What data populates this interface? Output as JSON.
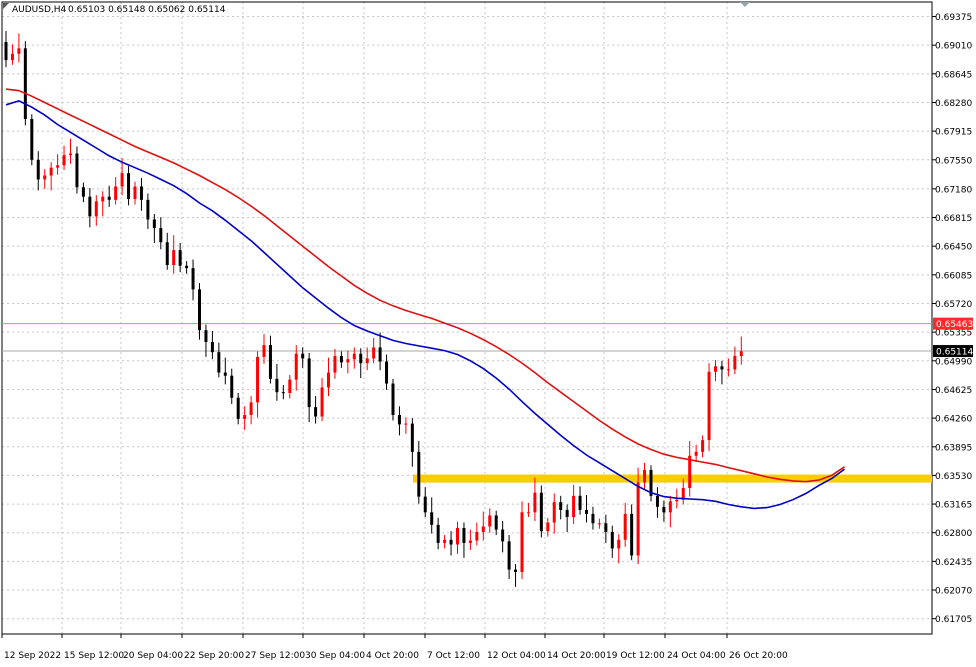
{
  "header": {
    "symbol": "AUDUSD,H4",
    "ohlc": "0.65103 0.65148 0.65062 0.65114"
  },
  "colors": {
    "bull": "#ff0000",
    "bear": "#000000",
    "ma_fast": "#0000c8",
    "ma_slow": "#e01010",
    "support": "#ffcc00",
    "bid_line": "#a9a9a9",
    "alert_line": "#ff7f7f"
  },
  "chart_data": {
    "type": "candlestick",
    "symbol": "AUDUSD",
    "timeframe": "H4",
    "ylim": [
      0.6151,
      0.6956
    ],
    "y_ticks": [
      "0.69375",
      "0.69010",
      "0.68645",
      "0.68280",
      "0.67915",
      "0.67550",
      "0.67180",
      "0.66815",
      "0.66450",
      "0.66085",
      "0.65720",
      "0.65355",
      "0.64990",
      "0.64625",
      "0.64260",
      "0.63895",
      "0.63530",
      "0.63165",
      "0.62800",
      "0.62435",
      "0.62070",
      "0.61705"
    ],
    "x_ticks": [
      "12 Sep 2022",
      "15 Sep 12:00",
      "20 Sep 04:00",
      "22 Sep 20:00",
      "27 Sep 12:00",
      "30 Sep 04:00",
      "4 Oct 20:00",
      "7 Oct 12:00",
      "12 Oct 04:00",
      "14 Oct 20:00",
      "19 Oct 12:00",
      "24 Oct 04:00",
      "26 Oct 20:00"
    ],
    "price_labels": [
      {
        "name": "alert",
        "value": "0.65463"
      },
      {
        "name": "bid",
        "value": "0.65114"
      }
    ],
    "support_level": 0.6349,
    "support_start_index": 60,
    "grid": true,
    "series": [
      {
        "name": "open",
        "values": [
          0.6905,
          0.6882,
          0.689,
          0.6897,
          0.6807,
          0.6755,
          0.673,
          0.6735,
          0.6745,
          0.6748,
          0.6761,
          0.6763,
          0.672,
          0.6708,
          0.6683,
          0.6702,
          0.6708,
          0.6704,
          0.6721,
          0.6738,
          0.6705,
          0.6721,
          0.6704,
          0.6679,
          0.6668,
          0.665,
          0.6621,
          0.664,
          0.662,
          0.6617,
          0.659,
          0.6538,
          0.6523,
          0.651,
          0.6484,
          0.648,
          0.6452,
          0.6425,
          0.643,
          0.6446,
          0.6504,
          0.6519,
          0.6476,
          0.6459,
          0.6458,
          0.6475,
          0.6508,
          0.6502,
          0.644,
          0.6428,
          0.6465,
          0.6484,
          0.6505,
          0.6497,
          0.6501,
          0.6508,
          0.6496,
          0.6502,
          0.6516,
          0.6498,
          0.647,
          0.643,
          0.6418,
          0.6419,
          0.6383,
          0.6326,
          0.6306,
          0.629,
          0.6267,
          0.6271,
          0.6265,
          0.6286,
          0.6267,
          0.627,
          0.6281,
          0.6288,
          0.6302,
          0.6284,
          0.6269,
          0.6233,
          0.623,
          0.6306,
          0.6306,
          0.6331,
          0.6282,
          0.6293,
          0.6319,
          0.6309,
          0.63,
          0.6327,
          0.6309,
          0.6304,
          0.6292,
          0.6292,
          0.6281,
          0.626,
          0.6271,
          0.6304,
          0.6251,
          0.6344,
          0.636,
          0.6327,
          0.6313,
          0.6306,
          0.632,
          0.6322,
          0.6337,
          0.6378,
          0.6383,
          0.6398,
          0.6485,
          0.6492,
          0.6488,
          0.6488,
          0.6505
        ]
      },
      {
        "name": "close",
        "values": [
          0.6882,
          0.689,
          0.6897,
          0.6807,
          0.6755,
          0.673,
          0.6735,
          0.6745,
          0.6748,
          0.6761,
          0.6763,
          0.672,
          0.6708,
          0.6683,
          0.6702,
          0.6708,
          0.6704,
          0.6721,
          0.6738,
          0.6705,
          0.6721,
          0.6704,
          0.6679,
          0.6668,
          0.665,
          0.6621,
          0.664,
          0.662,
          0.6617,
          0.659,
          0.6538,
          0.6523,
          0.651,
          0.6484,
          0.648,
          0.6452,
          0.6425,
          0.643,
          0.6446,
          0.6504,
          0.6519,
          0.6476,
          0.6459,
          0.6458,
          0.6475,
          0.6508,
          0.6502,
          0.644,
          0.6428,
          0.6465,
          0.6484,
          0.6505,
          0.6497,
          0.6501,
          0.6508,
          0.6496,
          0.6502,
          0.6516,
          0.6498,
          0.647,
          0.643,
          0.6418,
          0.6419,
          0.6383,
          0.6326,
          0.6306,
          0.629,
          0.6267,
          0.6271,
          0.6265,
          0.6286,
          0.6267,
          0.627,
          0.6281,
          0.6288,
          0.6302,
          0.6284,
          0.6269,
          0.6233,
          0.623,
          0.6306,
          0.6306,
          0.6331,
          0.6282,
          0.6293,
          0.6319,
          0.6309,
          0.63,
          0.6327,
          0.6309,
          0.6304,
          0.6292,
          0.6292,
          0.6281,
          0.626,
          0.6271,
          0.6304,
          0.6251,
          0.6344,
          0.636,
          0.6327,
          0.6313,
          0.6306,
          0.632,
          0.6322,
          0.6337,
          0.6378,
          0.6383,
          0.6398,
          0.6485,
          0.6492,
          0.6488,
          0.6488,
          0.6505,
          0.6511
        ]
      },
      {
        "name": "ma_fast",
        "values": [
          0.6825,
          0.683,
          0.6822,
          0.6812,
          0.68,
          0.679,
          0.678,
          0.677,
          0.676,
          0.6752,
          0.6745,
          0.6738,
          0.673,
          0.6722,
          0.6712,
          0.67,
          0.669,
          0.6678,
          0.6665,
          0.6652,
          0.6637,
          0.6622,
          0.6607,
          0.6592,
          0.6579,
          0.6566,
          0.6554,
          0.6544,
          0.6537,
          0.6531,
          0.6525,
          0.6521,
          0.6518,
          0.6515,
          0.6512,
          0.6507,
          0.6499,
          0.6489,
          0.6477,
          0.6463,
          0.6447,
          0.6432,
          0.6418,
          0.6404,
          0.6391,
          0.6379,
          0.6369,
          0.6359,
          0.6349,
          0.6339,
          0.6331,
          0.6326,
          0.6324,
          0.6323,
          0.6322,
          0.632,
          0.6316,
          0.6313,
          0.6311,
          0.6312,
          0.6316,
          0.6322,
          0.633,
          0.634,
          0.6349,
          0.6361
        ]
      },
      {
        "name": "ma_slow",
        "values": [
          0.6845,
          0.6843,
          0.6836,
          0.6828,
          0.682,
          0.6812,
          0.6804,
          0.6796,
          0.6788,
          0.678,
          0.6772,
          0.6765,
          0.6758,
          0.6751,
          0.6743,
          0.6735,
          0.6726,
          0.6717,
          0.6707,
          0.6696,
          0.6684,
          0.6671,
          0.6658,
          0.6645,
          0.6632,
          0.6619,
          0.6607,
          0.6595,
          0.6585,
          0.6576,
          0.6569,
          0.6563,
          0.6558,
          0.6553,
          0.6547,
          0.6541,
          0.6534,
          0.6526,
          0.6517,
          0.6507,
          0.6496,
          0.6484,
          0.6471,
          0.6459,
          0.6447,
          0.6435,
          0.6423,
          0.6412,
          0.6402,
          0.6393,
          0.6386,
          0.638,
          0.6376,
          0.6373,
          0.637,
          0.6367,
          0.6363,
          0.6359,
          0.6355,
          0.6351,
          0.6348,
          0.6346,
          0.6345,
          0.6347,
          0.6353,
          0.6364
        ]
      }
    ]
  }
}
